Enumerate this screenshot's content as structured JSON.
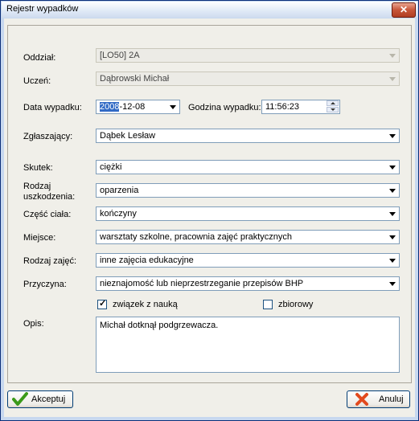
{
  "window": {
    "title": "Rejestr wypadków",
    "close_glyph": "✕"
  },
  "form": {
    "oddzial": {
      "label": "Oddział:",
      "value": "[LO50] 2A"
    },
    "uczen": {
      "label": "Uczeń:",
      "value": "Dąbrowski Michał"
    },
    "data": {
      "label": "Data wypadku:",
      "value_selected": "2008",
      "value_rest": "-12-08"
    },
    "godzina": {
      "label": "Godzina wypadku:",
      "value": "11:56:23"
    },
    "zglaszajacy": {
      "label": "Zgłaszający:",
      "value": "Dąbek Lesław"
    },
    "skutek": {
      "label": "Skutek:",
      "value": "ciężki"
    },
    "rodzaj_uszkodzenia": {
      "label_line1": "Rodzaj",
      "label_line2": "uszkodzenia:",
      "value": "oparzenia"
    },
    "czesc_ciala": {
      "label": "Część ciała:",
      "value": "kończyny"
    },
    "miejsce": {
      "label": "Miejsce:",
      "value": "warsztaty szkolne, pracownia zajęć praktycznych"
    },
    "rodzaj_zajec": {
      "label": "Rodzaj zajęć:",
      "value": "inne zajęcia edukacyjne"
    },
    "przyczyna": {
      "label": "Przyczyna:",
      "value": "nieznajomość lub nieprzestrzeganie przepisów BHP"
    },
    "zwiazek": {
      "label": "związek z nauką",
      "checked": true,
      "mark": "✓"
    },
    "zbiorowy": {
      "label": "zbiorowy",
      "checked": false
    },
    "opis": {
      "label": "Opis:",
      "value": "Michał dotknął podgrzewacza."
    }
  },
  "buttons": {
    "accept": {
      "label": "Akceptuj",
      "icon": "checkmark-icon",
      "color": "#3a9a1a"
    },
    "cancel": {
      "label": "Anuluj",
      "icon": "x-cross-icon",
      "color": "#e24a1e"
    }
  }
}
